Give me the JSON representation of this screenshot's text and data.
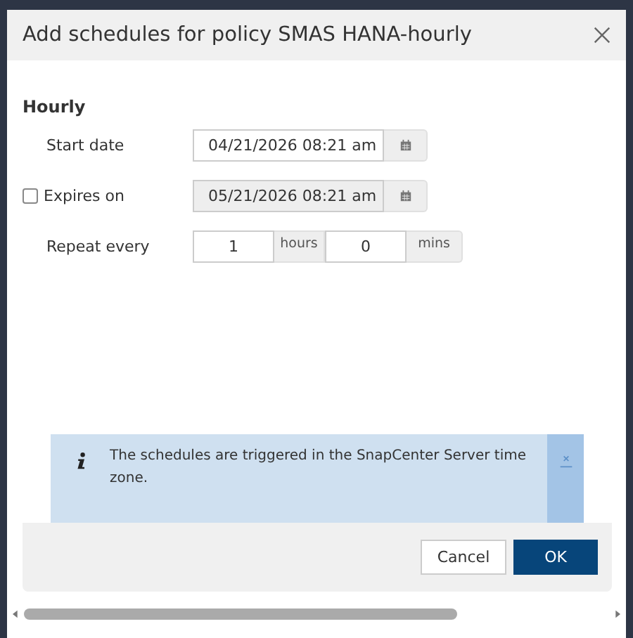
{
  "dialog": {
    "title": "Add schedules for policy SMAS HANA-hourly"
  },
  "section": "Hourly",
  "fields": [
    {
      "kind": "date",
      "label": "Start date",
      "value": "04/21/2026 08:21 am",
      "disabled": false
    },
    {
      "kind": "optionaldate",
      "label": "Expires on",
      "value": "05/21/2026 08:21 am",
      "disabled": true,
      "checked": false
    },
    {
      "kind": "repeat",
      "label": "Repeat every",
      "parts": [
        {
          "value": "1",
          "unit": "hours"
        },
        {
          "value": "0",
          "unit": "mins"
        }
      ]
    }
  ],
  "notice": {
    "text": "The schedules are triggered in the SnapCenter Server time zone."
  },
  "buttons": [
    {
      "label": "Cancel",
      "kind": "secondary"
    },
    {
      "label": "OK",
      "kind": "primary"
    }
  ]
}
